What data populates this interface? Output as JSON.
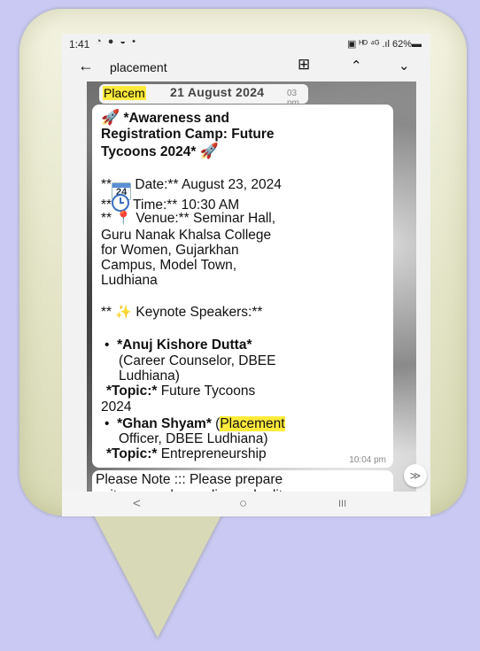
{
  "status": {
    "time": "1:41",
    "left_icons": "◔ ● ◒ •",
    "right": "▣ ᴴᴰ ⁴ᴳ .ıl 62%▬"
  },
  "search": {
    "query": "placement",
    "back": "←",
    "calendar": "⊞",
    "up": "⌃",
    "down": "⌄"
  },
  "date_chip": {
    "highlight": "Placem",
    "date": "21 August 2024",
    "time": "03 pm"
  },
  "message": {
    "title1": " *Awareness and",
    "title2": "Registration Camp: Future",
    "title3": "Tycoons 2024* ",
    "date_prefix": "**",
    "calendar_day": "24",
    "date_text": " Date:** August 23, 2024",
    "time_prefix": "**",
    "time_text": " Time:** 10:30 AM",
    "venue_prefix": "** ",
    "venue_text": " Venue:** Seminar Hall,",
    "venue2": "Guru Nanak Khalsa College",
    "venue3": "for Women, Gujarkhan",
    "venue4": "Campus, Model Town,",
    "venue5": "Ludhiana",
    "keynote_prefix": "** ",
    "keynote_text": " Keynote Speakers:**",
    "speaker1_bullet": "•",
    "speaker1_name": "*Anuj Kishore Dutta*",
    "speaker1_role1": "(Career Counselor, DBEE",
    "speaker1_role2": "Ludhiana)",
    "topic1_label": "*Topic:*",
    "topic1_text": " Future Tycoons",
    "topic1_text2": "2024",
    "speaker2_bullet": "•",
    "speaker2_name": "*Ghan Shyam*",
    "speaker2_paren": " (",
    "speaker2_highlight": "Placement",
    "speaker2_role2": "Officer, DBEE Ludhiana)",
    "topic2_label": "*Topic:*",
    "topic2_text": " Entrepreneurship",
    "time_sent": "10:04 pm"
  },
  "note": {
    "line1": "Please Note ::: Please prepare",
    "line2": "write ups a day earlier and edit"
  },
  "nav": {
    "back": "<",
    "home": "○",
    "recents": "III"
  },
  "scroll_down": "≫",
  "colors": {
    "background": "#c9c9f3",
    "bubble": "#e3e4c6",
    "highlight": "#ffeb3b"
  }
}
